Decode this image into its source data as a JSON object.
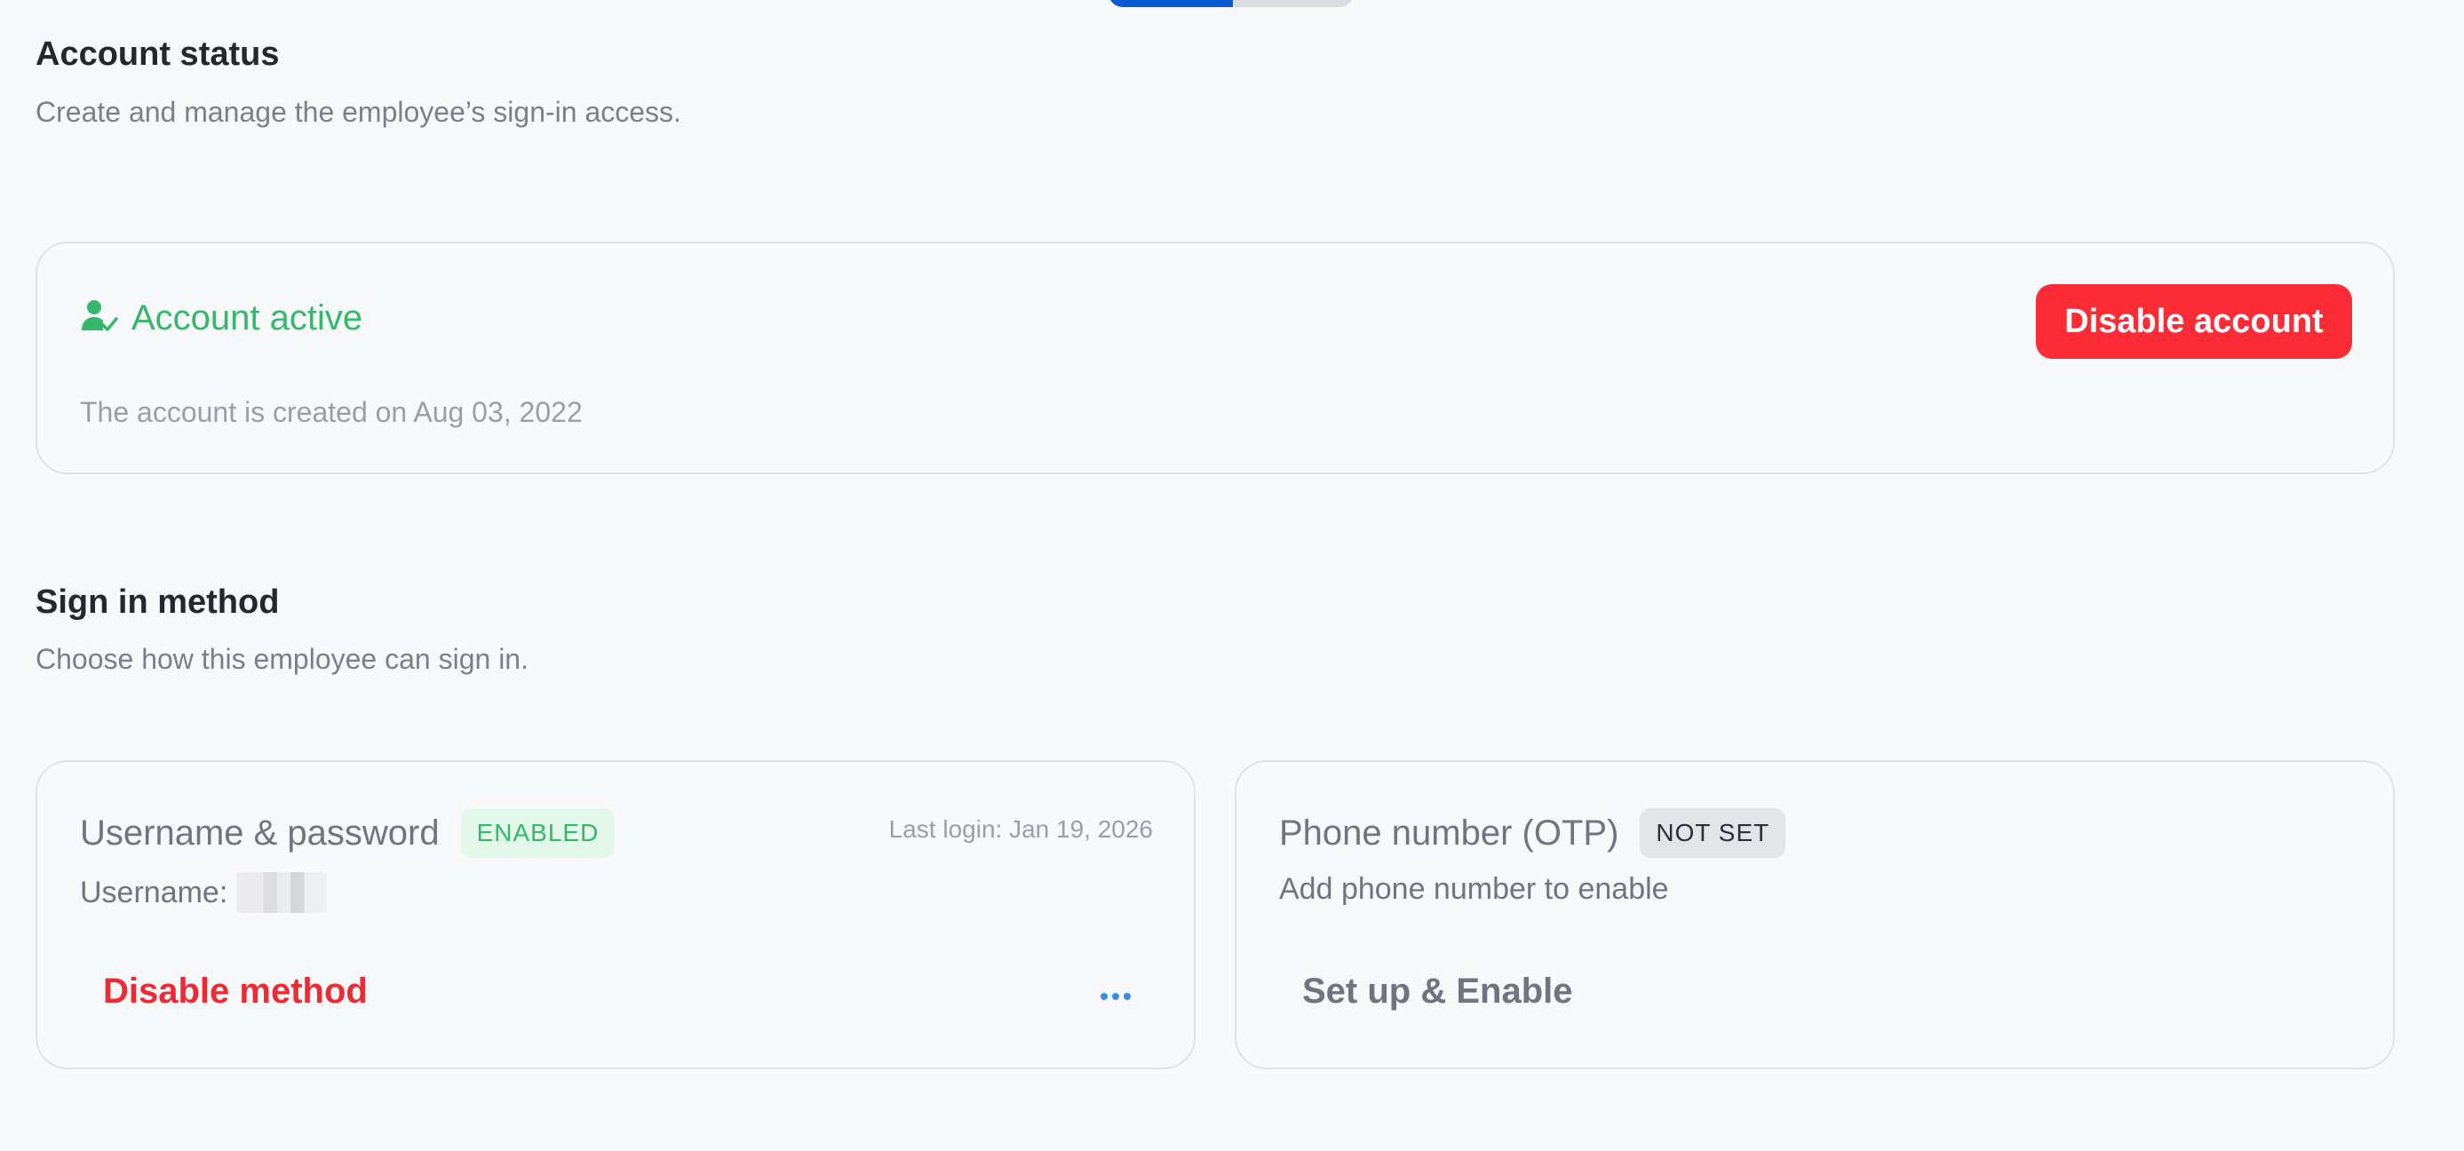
{
  "account_status": {
    "title": "Account status",
    "subtitle": "Create and manage the employee’s sign-in access.",
    "status_label": "Account active",
    "status_icon": "user-check-icon",
    "status_color": "#35b86a",
    "created_text": "The account is created on Aug 03, 2022",
    "disable_button_label": "Disable account",
    "disable_button_color": "#fb2c36"
  },
  "sign_in_method": {
    "title": "Sign in method",
    "subtitle": "Choose how this employee can sign in.",
    "methods": [
      {
        "name": "Username & password",
        "badge": "ENABLED",
        "last_login": "Last login: Jan 19, 2026",
        "detail_label": "Username:",
        "action_label": "Disable method",
        "more_icon": "more-horizontal-icon"
      },
      {
        "name": "Phone number (OTP)",
        "badge": "NOT SET",
        "detail": "Add phone number to enable",
        "action_label": "Set up & Enable"
      }
    ]
  }
}
